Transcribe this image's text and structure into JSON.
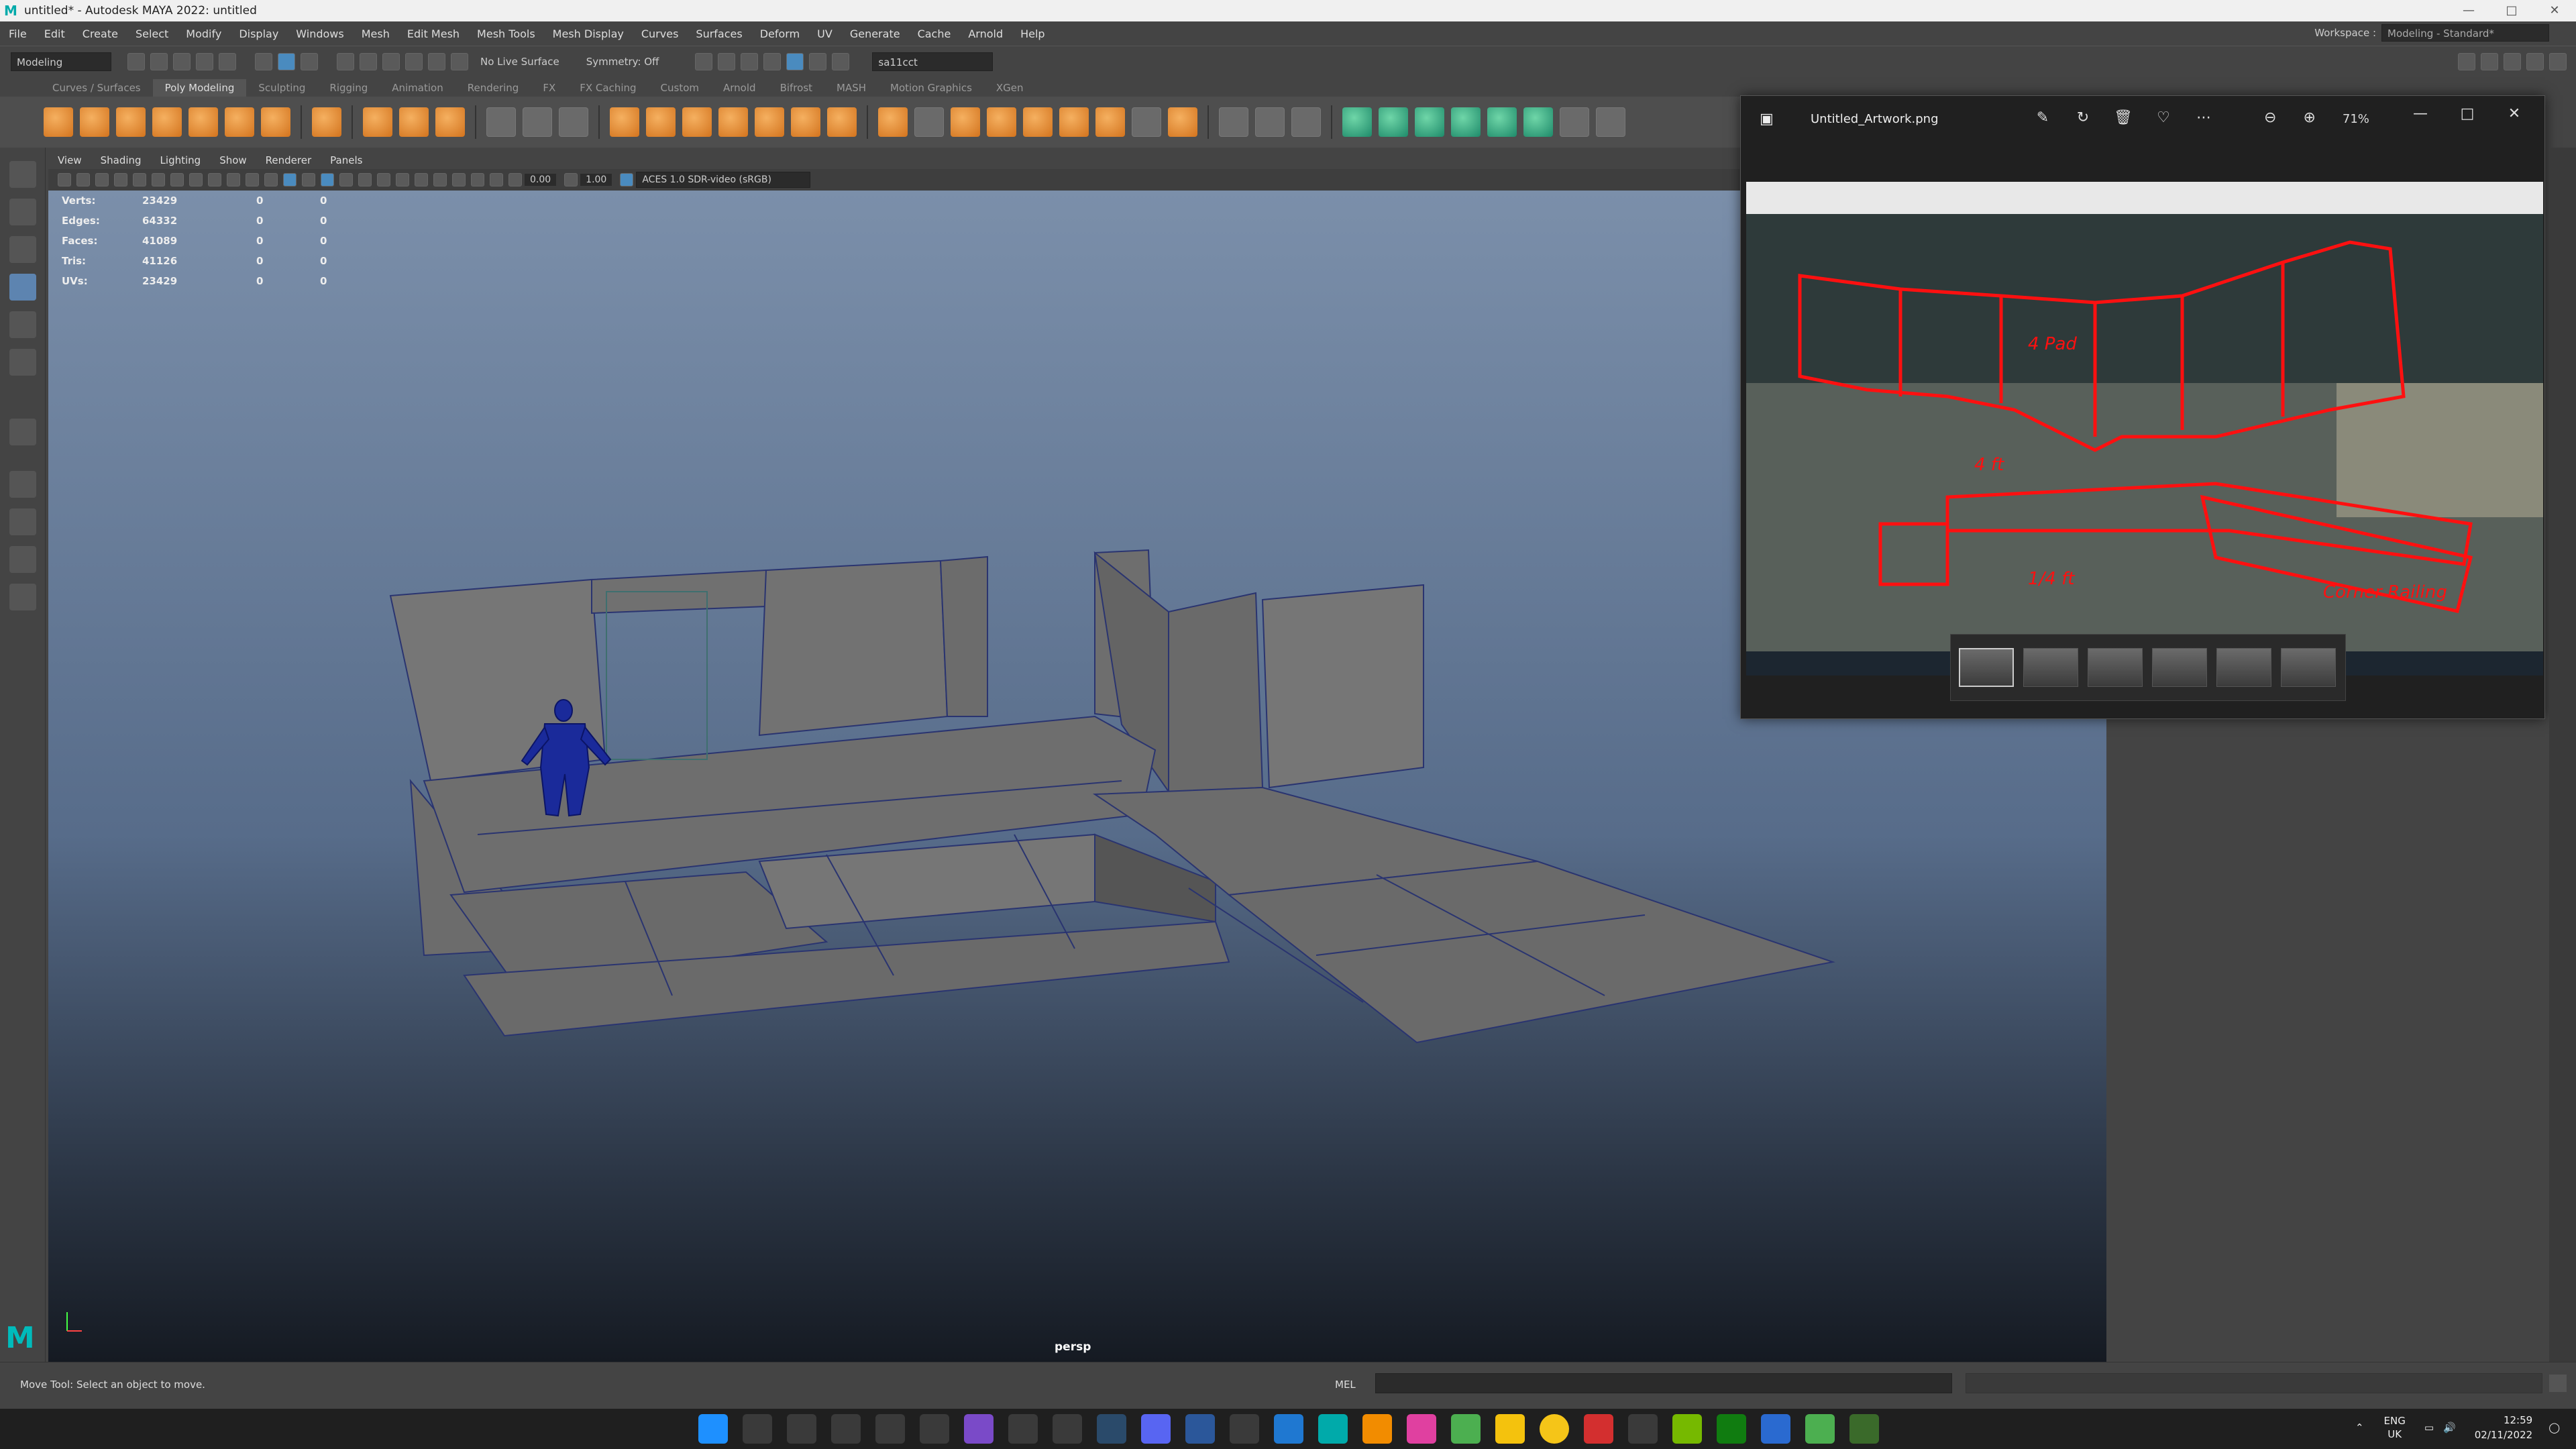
{
  "window": {
    "title": "untitled* - Autodesk MAYA 2022: untitled",
    "logo": "M"
  },
  "menu": [
    "File",
    "Edit",
    "Create",
    "Select",
    "Modify",
    "Display",
    "Windows",
    "Mesh",
    "Edit Mesh",
    "Mesh Tools",
    "Mesh Display",
    "Curves",
    "Surfaces",
    "Deform",
    "UV",
    "Generate",
    "Cache",
    "Arnold",
    "Help"
  ],
  "workspace": {
    "label": "Workspace :",
    "value": "Modeling - Standard*"
  },
  "statusline": {
    "mode": "Modeling",
    "live_surface": "No Live Surface",
    "symmetry": "Symmetry: Off",
    "camera": "sa11cct"
  },
  "shelf_tabs": [
    "Curves / Surfaces",
    "Poly Modeling",
    "Sculpting",
    "Rigging",
    "Animation",
    "Rendering",
    "FX",
    "FX Caching",
    "Custom",
    "Arnold",
    "Bifrost",
    "MASH",
    "Motion Graphics",
    "XGen"
  ],
  "shelf_active": "Poly Modeling",
  "viewport_menu": [
    "View",
    "Shading",
    "Lighting",
    "Show",
    "Renderer",
    "Panels"
  ],
  "viewport_tools": {
    "exposure": "0.00",
    "gamma": "1.00",
    "colorspace": "ACES 1.0 SDR-video (sRGB)"
  },
  "hud": [
    {
      "label": "Verts:",
      "value": "23429",
      "a": "0",
      "b": "0"
    },
    {
      "label": "Edges:",
      "value": "64332",
      "a": "0",
      "b": "0"
    },
    {
      "label": "Faces:",
      "value": "41089",
      "a": "0",
      "b": "0"
    },
    {
      "label": "Tris:",
      "value": "41126",
      "a": "0",
      "b": "0"
    },
    {
      "label": "UVs:",
      "value": "23429",
      "a": "0",
      "b": "0"
    }
  ],
  "camera_label": "persp",
  "photo_viewer": {
    "filename": "Untitled_Artwork.png",
    "zoom": "71%",
    "annotations": [
      "4 Pad",
      "4 ft",
      "1/4 ft",
      "Corner Railing"
    ]
  },
  "command": {
    "help": "Move Tool: Select an object to move.",
    "lang": "MEL"
  },
  "taskbar": {
    "lang_top": "ENG",
    "lang_bottom": "UK",
    "time": "12:59",
    "date": "02/11/2022"
  }
}
